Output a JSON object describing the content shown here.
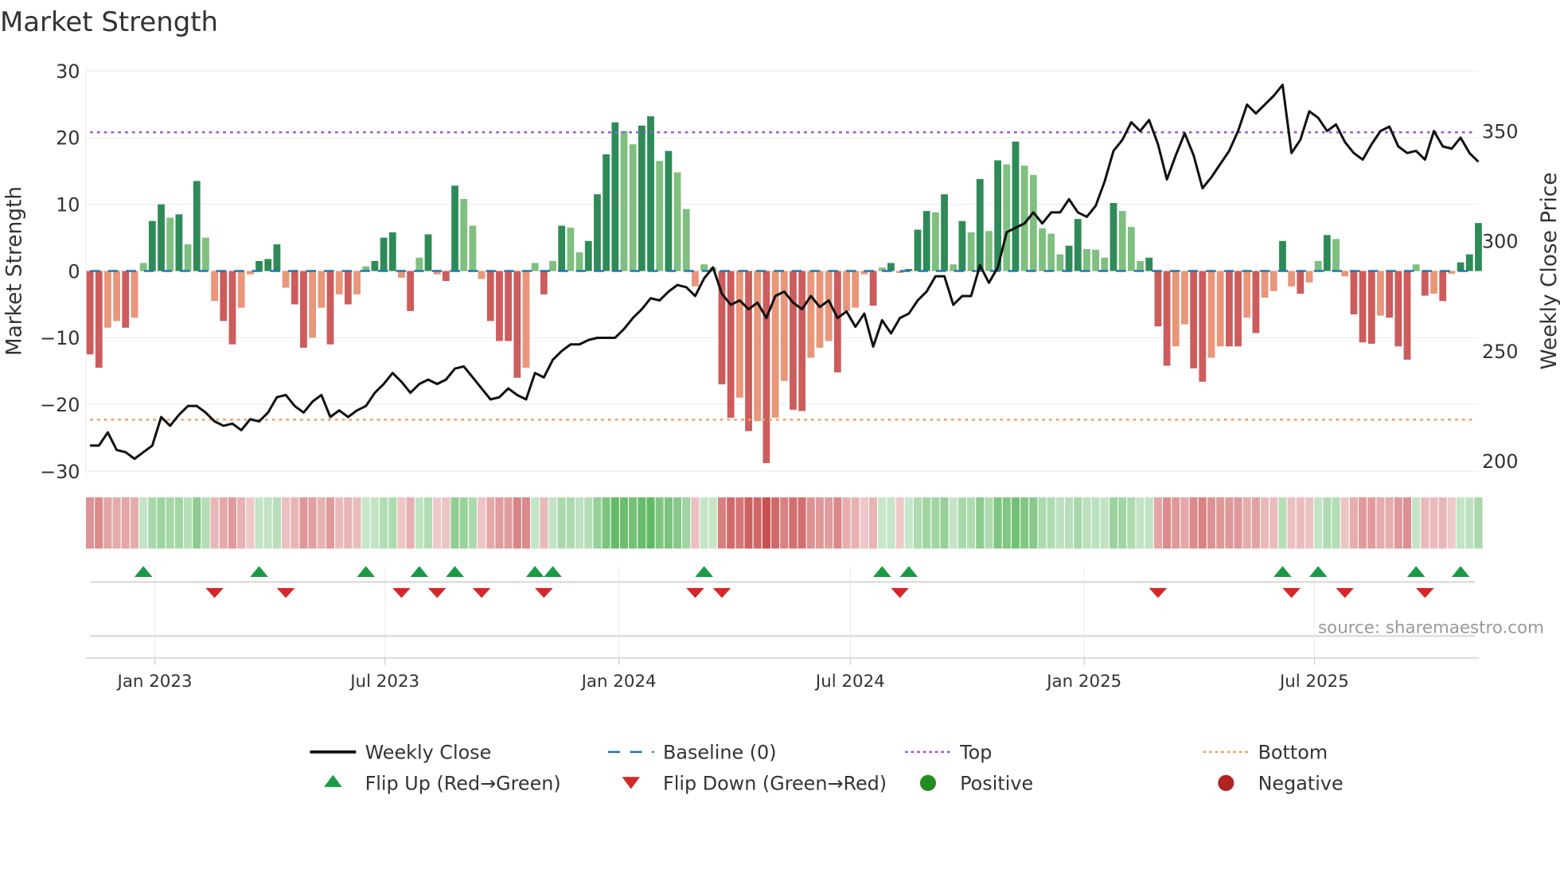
{
  "chart_data": {
    "type": "bar",
    "title": "Market Strength",
    "ylabel": "Market Strength",
    "y2label": "Weekly Close Price",
    "ylim": [
      -30,
      30
    ],
    "y2lim": [
      200,
      350
    ],
    "yticks": [
      "30",
      "20",
      "10",
      "0",
      "−10",
      "−20",
      "−30"
    ],
    "ytick_values": [
      30,
      20,
      10,
      0,
      -10,
      -20,
      -30
    ],
    "y2ticks": [
      "350",
      "300",
      "250",
      "200"
    ],
    "y2tick_values": [
      350,
      300,
      250,
      200
    ],
    "x_start": "2022-11-11",
    "x_step_days": 7,
    "xticks": [
      {
        "label": "Jan 2023",
        "date": "2023-01-01"
      },
      {
        "label": "Jul 2023",
        "date": "2023-07-01"
      },
      {
        "label": "Jan 2024",
        "date": "2024-01-01"
      },
      {
        "label": "Jul 2024",
        "date": "2024-07-01"
      },
      {
        "label": "Jan 2025",
        "date": "2025-01-01"
      },
      {
        "label": "Jul 2025",
        "date": "2025-07-01"
      }
    ],
    "top": 20.8,
    "bottom": -22.3,
    "baseline": 0,
    "strength": [
      -12.5,
      -14.5,
      -8.5,
      -7.5,
      -8.5,
      -7,
      1.2,
      7.5,
      10,
      8,
      8.5,
      4,
      13.5,
      5,
      -4.5,
      -7.5,
      -11,
      -5.5,
      -0.5,
      1.5,
      1.8,
      4,
      -2.5,
      -5,
      -11.5,
      -10,
      -5.5,
      -11,
      -3.5,
      -5,
      -3.5,
      0.7,
      1.5,
      5,
      5.8,
      -1,
      -6,
      2,
      5.5,
      -0.5,
      -1.5,
      12.8,
      10.8,
      6.8,
      -1.2,
      -7.5,
      -10.5,
      -10.5,
      -16,
      -14.5,
      1.2,
      -3.5,
      1.5,
      6.8,
      6.5,
      2.8,
      4.5,
      11.5,
      17.5,
      22.3,
      21,
      19,
      21.8,
      23.2,
      16.5,
      18,
      14.8,
      9.3,
      -2.3,
      1,
      0.5,
      -17,
      -22,
      -19,
      -24,
      -22.5,
      -28.8,
      -22,
      -16.5,
      -20.8,
      -21,
      -13,
      -11.5,
      -10.5,
      -15.2,
      -6,
      -5.5,
      -0.5,
      -5.2,
      0.5,
      1.2,
      -0.3,
      0.3,
      6.2,
      9,
      8.8,
      11.5,
      1,
      7.5,
      5.8,
      13.8,
      6,
      16.6,
      16,
      19.4,
      15.8,
      14.4,
      6.4,
      5.6,
      2.5,
      3.8,
      7.8,
      3.3,
      3.2,
      2,
      10.2,
      9,
      6.6,
      1.5,
      2,
      -8.3,
      -14.2,
      -11.3,
      -8,
      -14.6,
      -16.6,
      -13,
      -11.3,
      -11.3,
      -11.3,
      -7,
      -9.3,
      -4,
      -3,
      4.5,
      -2.3,
      -3.4,
      -1.7,
      1.5,
      5.4,
      4.8,
      -0.8,
      -6.5,
      -10.7,
      -10.9,
      -6.7,
      -7,
      -11.3,
      -13.3,
      1,
      -3.7,
      -3.4,
      -4.5,
      -0.4,
      1.3,
      2.5,
      7.2
    ],
    "weekly_close": [
      207,
      207,
      213,
      205,
      204,
      201,
      204,
      207,
      220,
      216,
      221,
      225,
      225,
      222,
      218,
      216,
      217,
      214,
      219,
      218,
      222,
      229,
      230,
      225,
      222,
      227,
      230,
      220,
      223,
      220,
      223,
      225,
      231,
      235,
      240,
      236,
      231,
      235,
      237,
      235,
      237,
      242,
      243,
      238,
      233,
      228,
      229,
      233,
      230,
      228,
      240,
      238,
      246,
      250,
      253,
      253,
      255,
      256,
      256,
      256,
      260,
      265,
      269,
      274,
      273,
      277,
      280,
      279,
      275,
      283,
      288,
      276,
      271,
      273,
      269,
      272,
      265,
      275,
      277,
      272,
      269,
      275,
      270,
      273,
      265,
      268,
      261,
      267,
      252,
      264,
      258,
      265,
      267,
      273,
      277,
      284,
      284,
      271,
      275,
      275,
      289,
      281,
      288,
      304,
      306,
      308,
      313,
      308,
      313,
      313,
      319,
      313,
      311,
      316,
      327,
      341,
      346,
      354,
      350,
      355,
      344,
      328,
      339,
      349,
      339,
      324,
      329,
      335,
      341,
      350,
      362,
      358,
      362,
      366,
      371,
      340,
      346,
      359,
      356,
      350,
      353,
      345,
      340,
      337,
      344,
      350,
      352,
      343,
      340,
      341,
      337,
      350,
      343,
      342,
      347,
      340,
      336
    ],
    "flip_up_weeks": [
      6,
      19,
      31,
      37,
      41,
      50,
      52,
      69,
      89,
      92,
      134,
      138,
      149,
      154
    ],
    "flip_down_weeks": [
      14,
      22,
      35,
      39,
      44,
      51,
      68,
      71,
      91,
      120,
      135,
      141,
      150
    ],
    "legend": [
      {
        "label": "Weekly Close",
        "kind": "line"
      },
      {
        "label": "Baseline (0)",
        "kind": "baseline"
      },
      {
        "label": "Top",
        "kind": "top"
      },
      {
        "label": "Bottom",
        "kind": "bottom"
      },
      {
        "label": "Flip Up (Red→Green)",
        "kind": "up"
      },
      {
        "label": "Flip Down (Green→Red)",
        "kind": "down"
      },
      {
        "label": "Positive",
        "kind": "pos"
      },
      {
        "label": "Negative",
        "kind": "neg"
      }
    ],
    "legend_placement": "bottom",
    "source": "source: sharemaestro.com"
  },
  "colors": {
    "pos_strong": "#2e8b57",
    "pos_weak": "#7fbf7f",
    "neg_strong": "#cd5c5c",
    "neg_weak": "#e9967a",
    "line": "#111111",
    "baseline": "#1f77b4",
    "top": "#9b59d6",
    "bottom": "#f0a060",
    "flip_up": "#1a9a45",
    "flip_down": "#d62728",
    "positive": "#228b22",
    "negative": "#b22222"
  }
}
